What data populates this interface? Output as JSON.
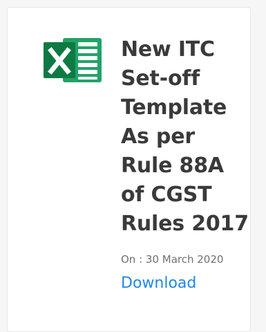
{
  "card": {
    "title": "New ITC\nSet-off\nTemplate\nAs per\nRule 88A\nof CGST\nRules 2017",
    "date_text": "On : 30 March 2020",
    "download_label": "Download"
  },
  "icons": {
    "file_icon": "excel-icon"
  },
  "colors": {
    "excel_green": "#21a366",
    "excel_dark_green": "#0e7a43",
    "link_blue": "#1e88e5",
    "title_gray": "#3a3a3a",
    "meta_gray": "#707070"
  }
}
